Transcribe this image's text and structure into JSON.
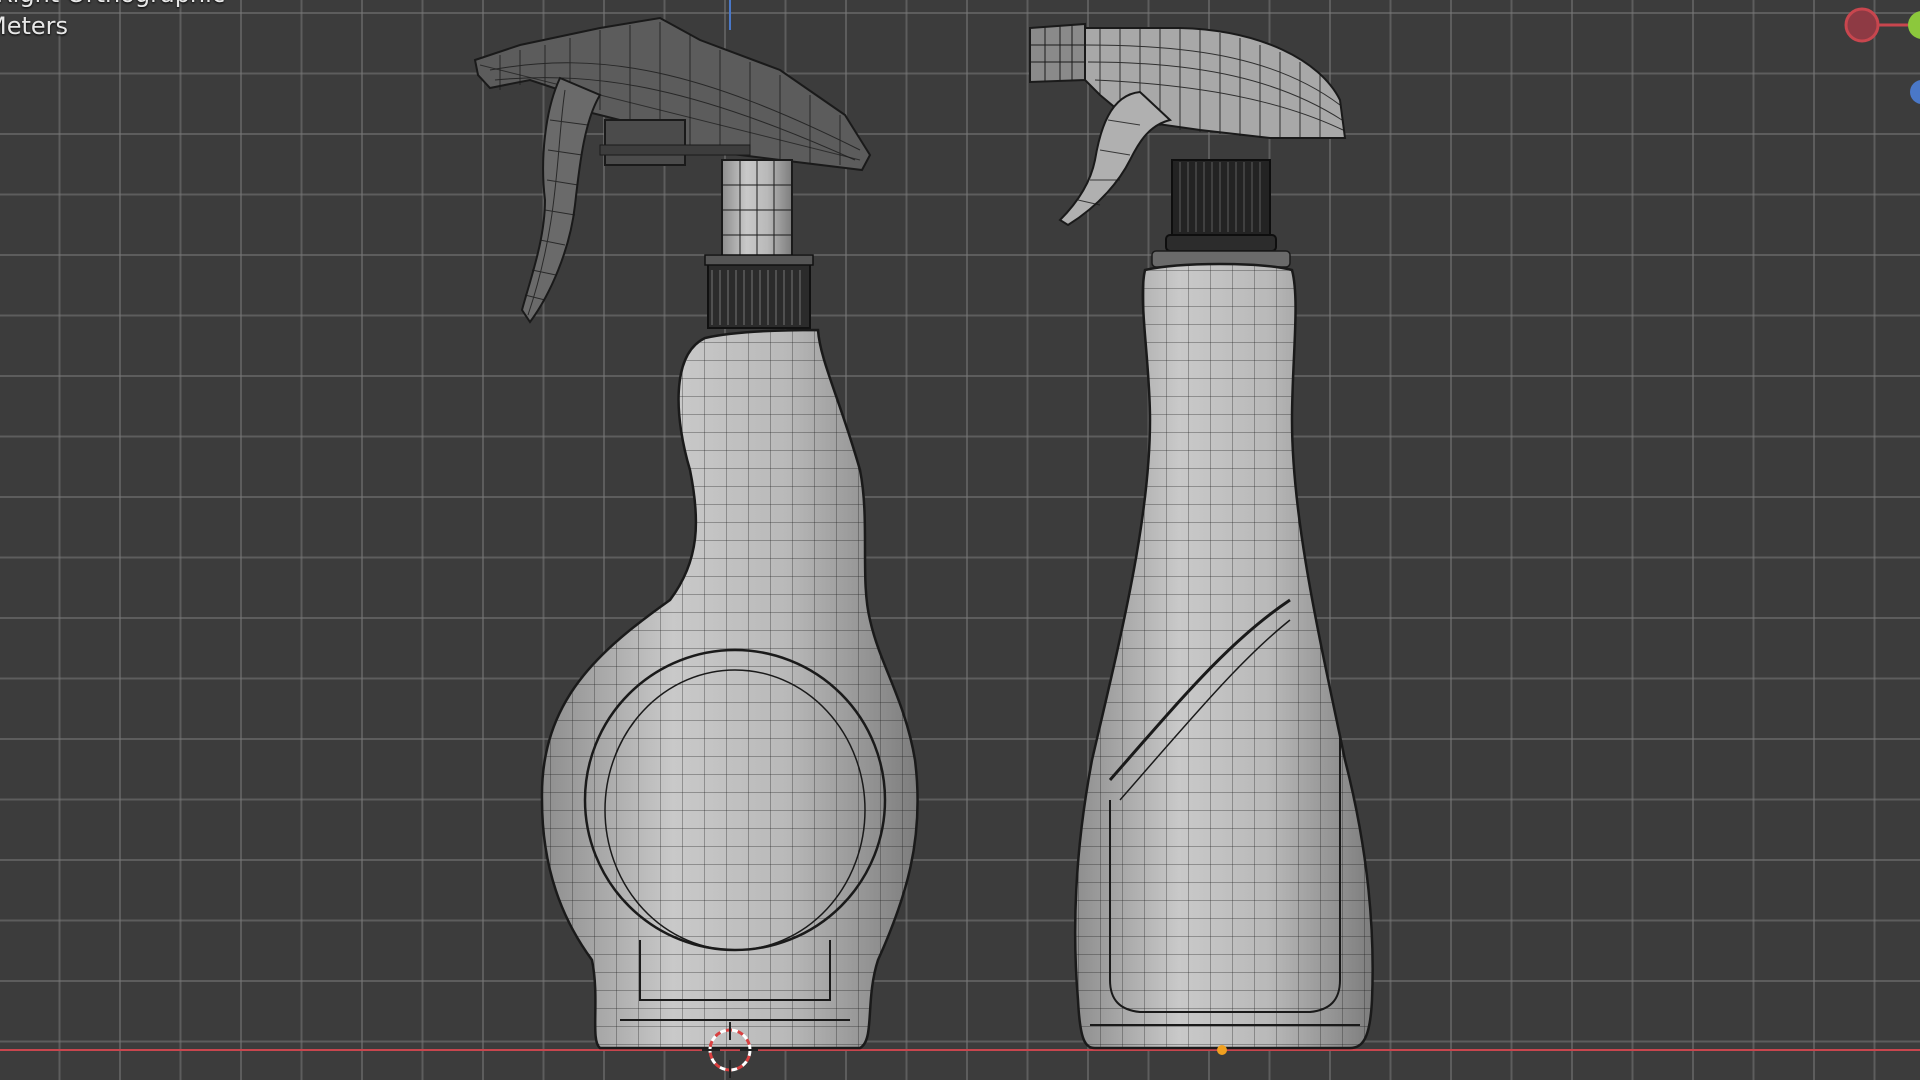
{
  "viewport": {
    "hud_title": "Right Orthographic",
    "hud_units": "Meters"
  },
  "axis_colors": {
    "x": "#c8464e",
    "y": "#8cc83c",
    "z": "#4a78c8"
  },
  "objects": [
    {
      "name": "spray-bottle-left",
      "mode": "wireframe-overlay"
    },
    {
      "name": "spray-bottle-right",
      "mode": "wireframe-overlay"
    }
  ],
  "icons": {
    "origin": "3d-cursor-icon",
    "pivot": "object-origin-icon",
    "gizmo": "navigation-gizmo-icon"
  }
}
